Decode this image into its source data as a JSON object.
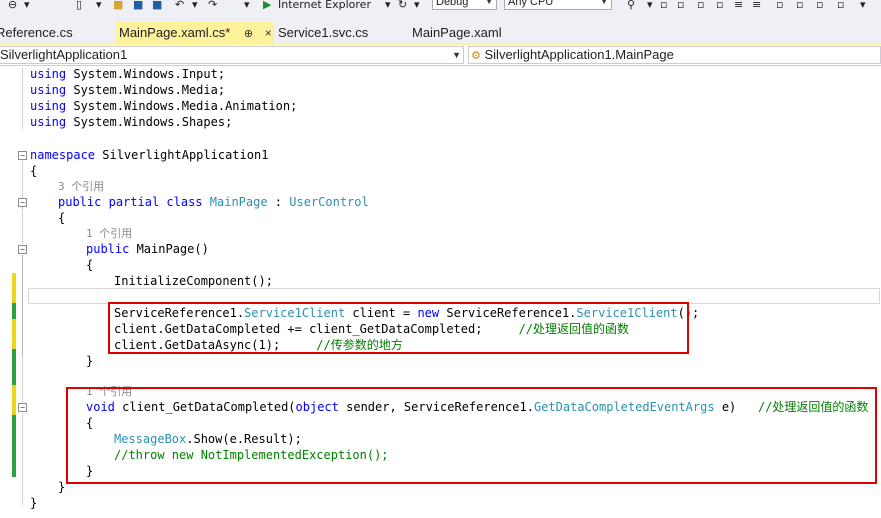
{
  "toolbar": {
    "browser": "Internet Explorer",
    "config": "Debug",
    "platform": "Any CPU"
  },
  "tabs": [
    {
      "label": "Reference.cs"
    },
    {
      "label": "MainPage.xaml.cs*",
      "pin": "⊕",
      "close": "×"
    },
    {
      "label": "Service1.svc.cs"
    },
    {
      "label": "MainPage.xaml"
    }
  ],
  "nav": {
    "project": "SilverlightApplication1",
    "member": "SilverlightApplication1.MainPage"
  },
  "code": {
    "using1": "System.Windows.Input;",
    "using2": "System.Windows.Media;",
    "using3": "System.Windows.Media.Animation;",
    "using4": "System.Windows.Shapes;",
    "kw_using": "using",
    "kw_namespace": "namespace",
    "ns_name": " SilverlightApplication1",
    "brace_open": "{",
    "brace_close": "}",
    "ref3": "3 个引用",
    "ref1a": "1 个引用",
    "ref1b": "1 个引用",
    "kw_public": "public",
    "kw_partial": "partial",
    "kw_class": "class",
    "class_name": "MainPage",
    "colon": " : ",
    "base_class": "UserControl",
    "ctor": " MainPage()",
    "init": "InitializeComponent();",
    "l1_a": "ServiceReference1.",
    "l1_b": "Service1Client",
    "l1_c": " client = ",
    "kw_new": "new",
    "l1_d": " ServiceReference1.",
    "l1_e": "Service1Client",
    "l1_f": "();",
    "l2_code": "client.GetDataCompleted += client_GetDataCompleted;     ",
    "l2_comment": "//处理返回值的函数",
    "l3_code": "client.GetDataAsync(1);     ",
    "l3_comment": "//传参数的地方",
    "kw_void": "void",
    "m_a": " client_GetDataCompleted(",
    "kw_object": "object",
    "m_b": " sender, ServiceReference1.",
    "m_type": "GetDataCompletedEventArgs",
    "m_c": " e)   ",
    "m_comment": "//处理返回值的函数",
    "mb_type": "MessageBox",
    "mb_rest": ".Show(e.Result);",
    "throw_comment": "//throw new NotImplementedException();"
  }
}
